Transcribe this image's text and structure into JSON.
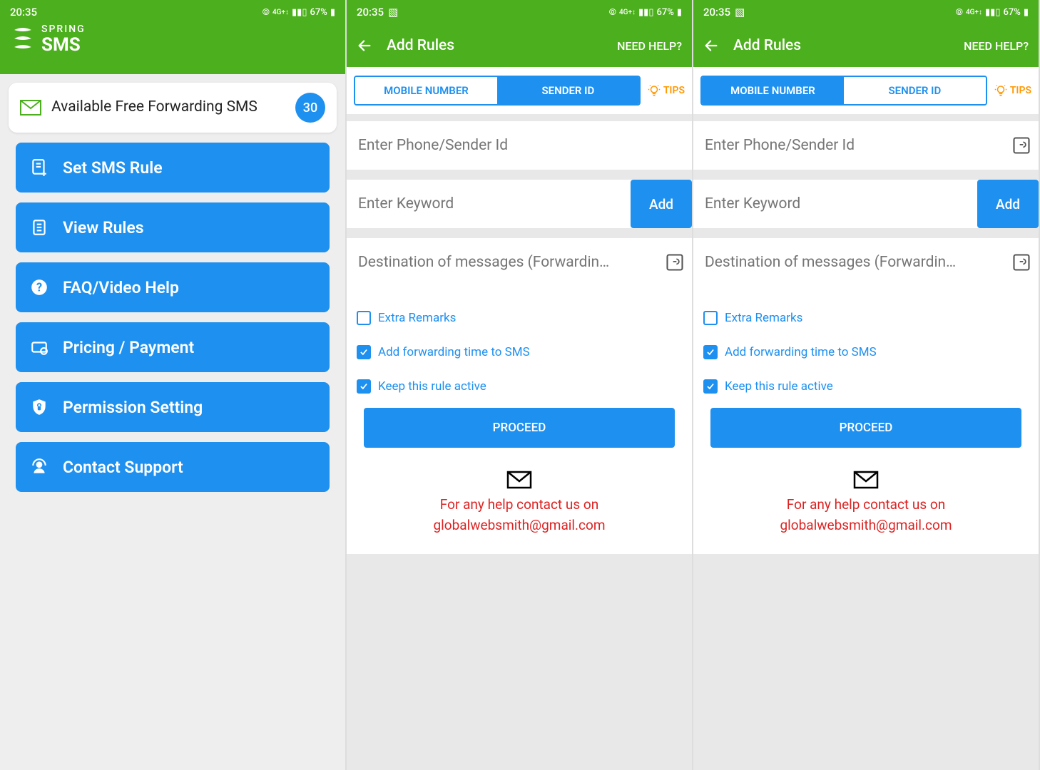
{
  "status": {
    "time": "20:35",
    "battery": "67%",
    "img_icon": "🖼"
  },
  "brand": {
    "line1": "SPRING",
    "line2": "SMS"
  },
  "screen1": {
    "card_title": "Available Free Forwarding SMS",
    "card_count": "30",
    "menu": [
      "Set SMS Rule",
      "View Rules",
      "FAQ/Video Help",
      "Pricing / Payment",
      "Permission Setting",
      "Contact Support"
    ]
  },
  "add_rules": {
    "title": "Add Rules",
    "help": "NEED HELP?",
    "tab_mobile": "MOBILE NUMBER",
    "tab_sender": "SENDER ID",
    "tips": "TIPS",
    "ph_sender": "Enter Phone/Sender Id",
    "ph_keyword": "Enter Keyword",
    "add_btn": "Add",
    "ph_dest": "Destination of messages (Forwardin…",
    "check_extra": "Extra Remarks",
    "check_fwd_time": "Add forwarding time to SMS",
    "check_active": "Keep this rule active",
    "proceed": "PROCEED",
    "help_line1": "For any help contact us on",
    "help_line2": "globalwebsmith@gmail.com"
  }
}
